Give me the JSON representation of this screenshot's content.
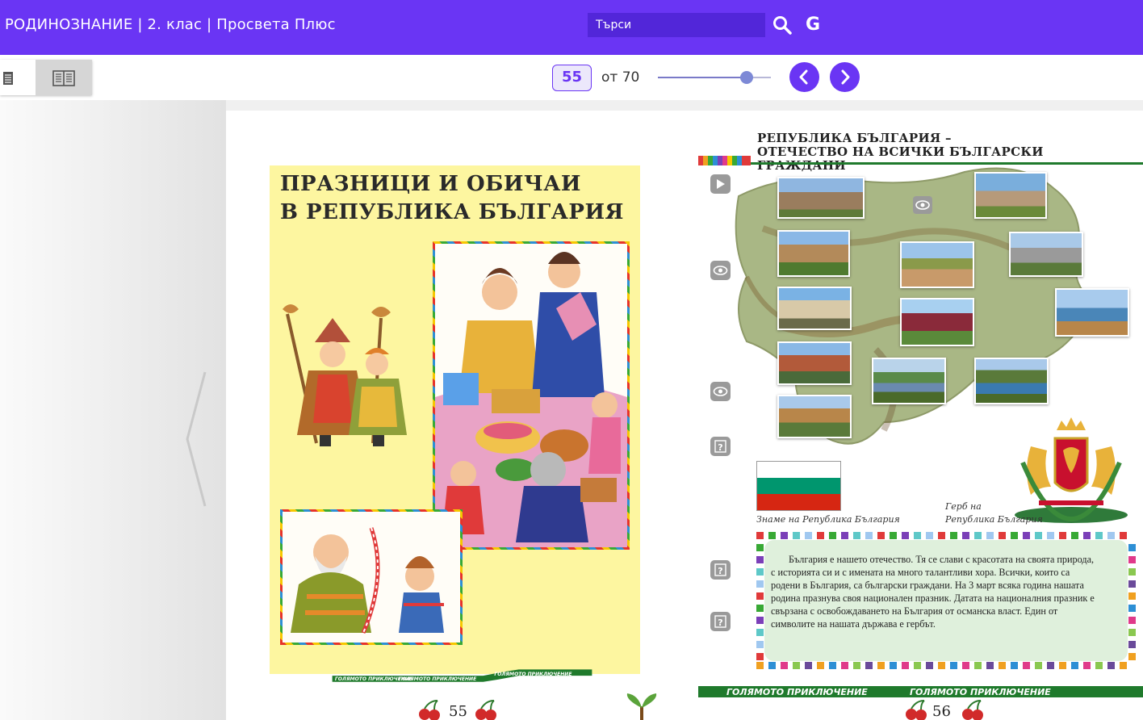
{
  "header": {
    "title": "РОДИНОЗНАНИЕ | 2. клас | Просвета Плюс",
    "search_placeholder": "Търси",
    "search_icon": "search-icon",
    "google_label": "G"
  },
  "toolbar": {
    "view_single_icon": "single-page-icon",
    "view_double_icon": "double-page-icon",
    "current_page": "55",
    "total_pages_label": "от 70",
    "page_progress": 0.786,
    "prev_icon": "chevron-left-icon",
    "next_icon": "chevron-right-icon",
    "accent_color": "#6a35f4"
  },
  "left_page": {
    "title_line1": "ПРАЗНИЦИ И ОБИЧАИ",
    "title_line2": "В РЕПУБЛИКА БЪЛГАРИЯ",
    "ribbon_text": "ГОЛЯМОТО ПРИКЛЮЧЕНИЕ",
    "page_number": "55"
  },
  "right_page": {
    "title_line1": "РЕПУБЛИКА БЪЛГАРИЯ –",
    "title_line2": "ОТЕЧЕСТВО НА ВСИЧКИ БЪЛГАРСКИ  ГРАЖДАНИ",
    "flag_caption": "Знаме на Република България",
    "coat_caption_line1": "Герб на",
    "coat_caption_line2": "Република България",
    "paragraph": "България е нашето отечество. Тя се слави с красотата на своята природа, с историята си и с имената на много талантливи хора. Всички, които са родени в България, са български граждани. На 3 март всяка година нашата родина празнува своя национален празник. Датата на националния празник е свързана с освобождаването на България от османска власт. Един от символите на нашата държава е гербът.",
    "ribbon_text": "ГОЛЯМОТО ПРИКЛЮЧЕНИЕ",
    "page_number": "56",
    "side_icons": [
      "video-icon",
      "eye-icon",
      "eye-icon",
      "question-icon",
      "question-icon",
      "question-icon"
    ]
  }
}
